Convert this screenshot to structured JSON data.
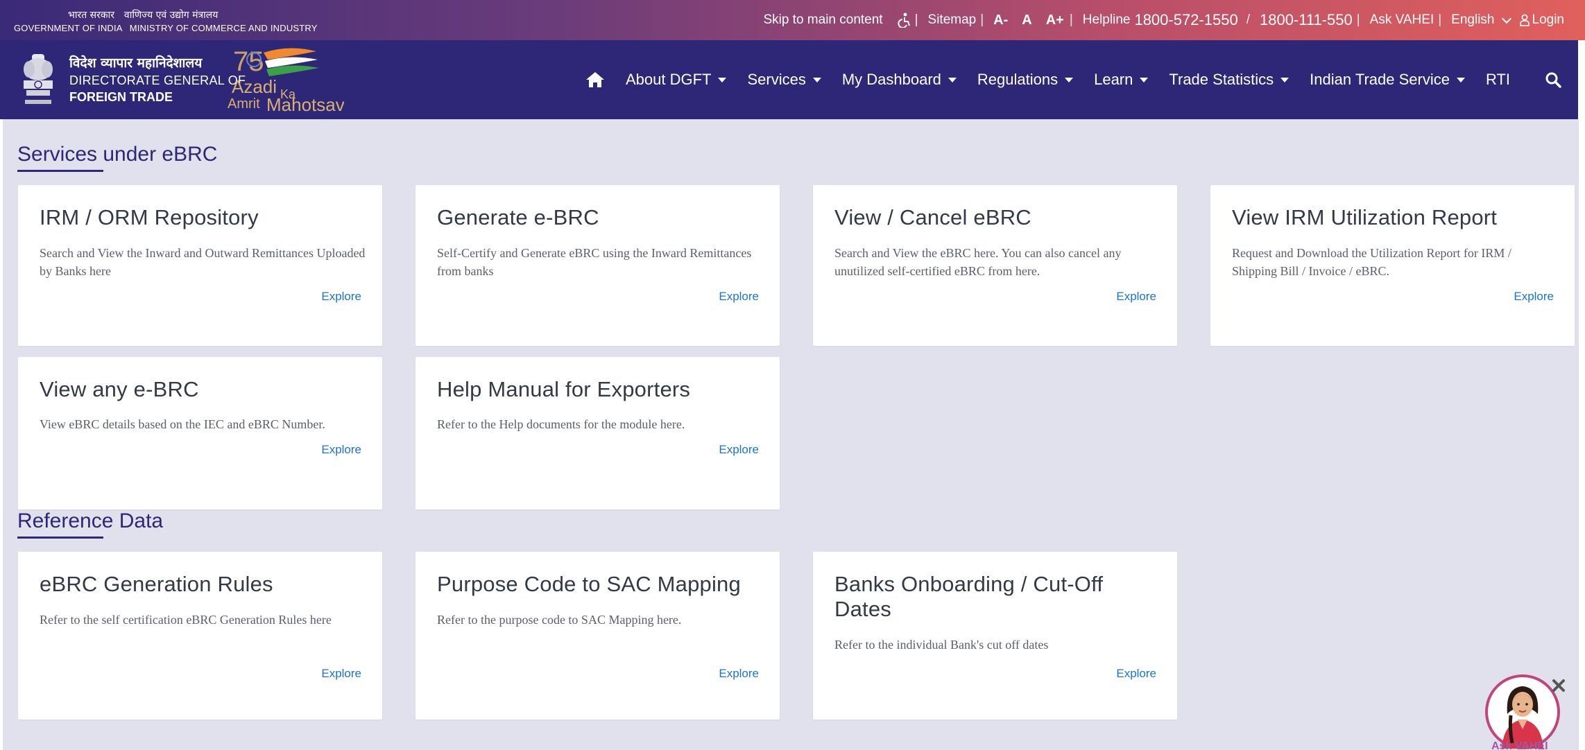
{
  "topbar": {
    "gov_hi_1": "भारत सरकार",
    "gov_hi_2": "वाणिज्य एवं उद्योग मंत्रालय",
    "gov_en_1": "GOVERNMENT OF INDIA",
    "gov_en_2": "MINISTRY OF COMMERCE AND INDUSTRY",
    "skip": "Skip to main content",
    "sitemap": "Sitemap",
    "font_minus": "A-",
    "font_normal": "A",
    "font_plus": "A+",
    "helpline_label": "Helpline",
    "helpline_1": "1800-572-1550",
    "helpline_2": "1800-111-550",
    "ask": "Ask VAHEI",
    "language": "English",
    "login": "Login",
    "separator": "|",
    "slash": "/"
  },
  "brand": {
    "hi": "विदेश व्यापार महानिदेशालय",
    "en_line1": "DIRECTORATE GENERAL OF",
    "en_line2": "FOREIGN TRADE",
    "azadi_1": "Azadi",
    "azadi_2": "Ka",
    "azadi_3": "Amrit",
    "azadi_4": "Mahotsav",
    "azadi_num": "75"
  },
  "nav": {
    "items": [
      {
        "label": "About DGFT"
      },
      {
        "label": "Services"
      },
      {
        "label": "My Dashboard"
      },
      {
        "label": "Regulations"
      },
      {
        "label": "Learn"
      },
      {
        "label": "Trade Statistics"
      },
      {
        "label": "Indian Trade Service"
      }
    ],
    "rti": "RTI"
  },
  "sections": {
    "services_title": "Services under eBRC",
    "reference_title": "Reference Data"
  },
  "cards": [
    {
      "title": "IRM / ORM Repository",
      "desc": "Search and View the Inward and Outward Remittances Uploaded by Banks here",
      "link": "Explore"
    },
    {
      "title": "Generate e-BRC",
      "desc": "Self-Certify and Generate eBRC using the Inward Remittances from banks",
      "link": "Explore"
    },
    {
      "title": "View / Cancel eBRC",
      "desc": "Search and View the eBRC here. You can also cancel any unutilized self-certified eBRC from here.",
      "link": "Explore"
    },
    {
      "title": "View IRM Utilization Report",
      "desc": "Request and Download the Utilization Report for IRM / Shipping Bill / Invoice / eBRC.",
      "link": "Explore"
    },
    {
      "title": "View any e-BRC",
      "desc": "View eBRC details based on the IEC and eBRC Number.",
      "link": "Explore"
    },
    {
      "title": "Help Manual for Exporters",
      "desc": "Refer to the Help documents for the module here.",
      "link": "Explore"
    },
    {
      "title": "eBRC Generation Rules",
      "desc": "Refer to the self certification eBRC Generation Rules here",
      "link": "Explore"
    },
    {
      "title": "Purpose Code to SAC Mapping",
      "desc": "Refer to the purpose code to SAC Mapping here.",
      "link": "Explore"
    },
    {
      "title": "Banks Onboarding / Cut-Off Dates",
      "desc": "Refer to the individual Bank's cut off dates",
      "link": "Explore"
    }
  ],
  "chat": {
    "label": "Ask VAHEI"
  },
  "colors": {
    "nav_bg": "#2e2676",
    "content_bg": "#e1e1ee",
    "link": "#1a73d9",
    "accent_gradient_end": "#e0605c"
  }
}
